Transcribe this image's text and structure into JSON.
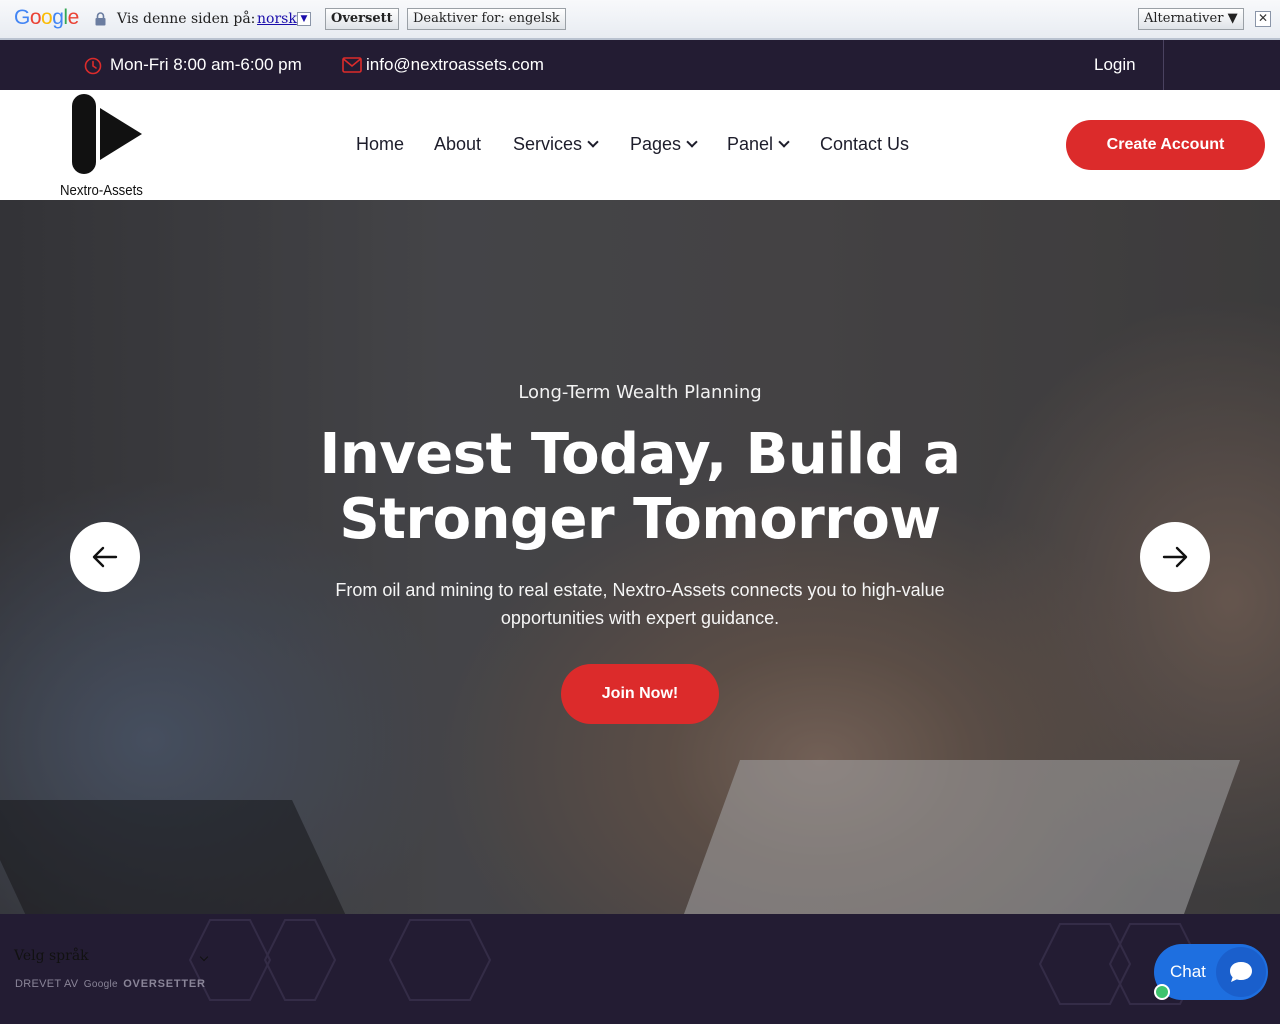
{
  "translate_bar": {
    "logo_text": "Google",
    "prompt": "Vis denne siden på:",
    "language": "norsk",
    "translate_label": "Oversett",
    "disable_label": "Deaktiver for: engelsk",
    "options_label": "Alternativer ▼",
    "close_symbol": "✕"
  },
  "topbar": {
    "hours": "Mon-Fri 8:00 am-6:00 pm",
    "email": "info@nextroassets.com",
    "login": "Login",
    "icon_color": "#dc2b2b"
  },
  "header": {
    "brand": "Nextro-Assets",
    "nav": [
      {
        "label": "Home",
        "has_dropdown": false
      },
      {
        "label": "About",
        "has_dropdown": false
      },
      {
        "label": "Services",
        "has_dropdown": true
      },
      {
        "label": "Pages",
        "has_dropdown": true
      },
      {
        "label": "Panel",
        "has_dropdown": true
      },
      {
        "label": "Contact Us",
        "has_dropdown": false
      }
    ],
    "cta": "Create Account"
  },
  "hero": {
    "eyebrow": "Long-Term Wealth Planning",
    "title": "Invest Today, Build a Stronger Tomorrow",
    "subtitle": "From oil and mining to real estate, Nextro-Assets connects you to high-value opportunities with expert guidance.",
    "button": "Join Now!",
    "prev_icon": "arrow-left-icon",
    "next_icon": "arrow-right-icon"
  },
  "footer": {
    "language_select": "Velg språk",
    "powered_prefix": "DREVET AV",
    "powered_google": "Google",
    "powered_product": "OVERSETTER"
  },
  "chat": {
    "label": "Chat",
    "online_color": "#3ec46d"
  },
  "colors": {
    "accent": "#dc2b2b",
    "dark": "#231c33",
    "chat_blue": "#1e6fe0"
  }
}
